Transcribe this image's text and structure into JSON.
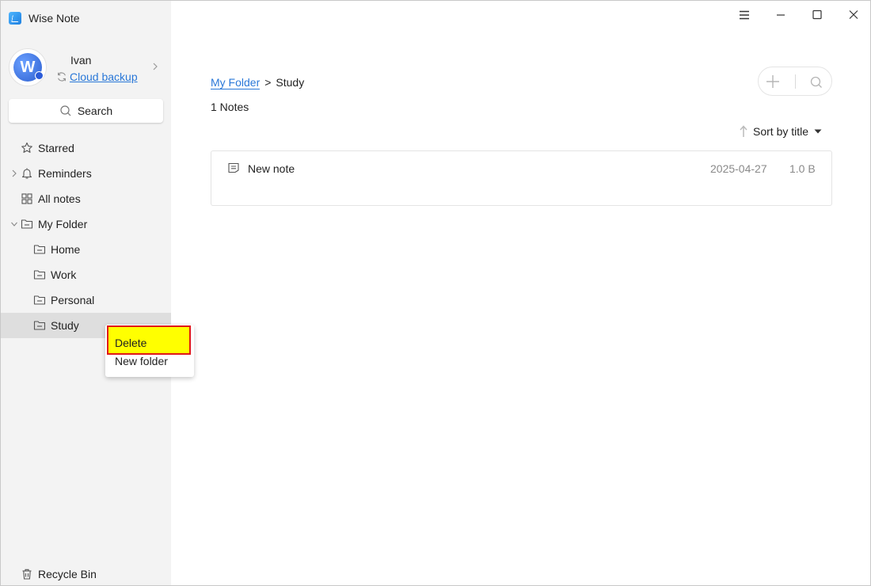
{
  "app": {
    "title": "Wise Note"
  },
  "profile": {
    "avatar_letter": "W",
    "name": "Ivan",
    "cloud_label": "Cloud backup"
  },
  "sidebar": {
    "search_label": "Search",
    "items": [
      {
        "label": "Starred",
        "icon": "star-icon"
      },
      {
        "label": "Reminders",
        "icon": "bell-icon",
        "expandable": true
      },
      {
        "label": "All notes",
        "icon": "grid-icon"
      },
      {
        "label": "My Folder",
        "icon": "folder-icon",
        "expanded": true
      },
      {
        "label": "Home",
        "icon": "folder-icon"
      },
      {
        "label": "Work",
        "icon": "folder-icon"
      },
      {
        "label": "Personal",
        "icon": "folder-icon"
      },
      {
        "label": "Study",
        "icon": "folder-icon",
        "selected": true
      }
    ],
    "recycle_bin": "Recycle Bin"
  },
  "main": {
    "breadcrumb": {
      "parent": "My Folder",
      "separator": ">",
      "current": "Study"
    },
    "note_count": "1 Notes",
    "sort_label": "Sort by title",
    "notes": [
      {
        "title": "New note",
        "date": "2025-04-27",
        "size": "1.0 B"
      }
    ]
  },
  "context_menu": {
    "items": [
      {
        "label": "Delete",
        "highlighted": true
      },
      {
        "label": "New folder"
      }
    ]
  },
  "colors": {
    "accent": "#2a78d8",
    "sidebar_bg": "#f3f3f3",
    "selected_bg": "#dedede",
    "highlight": "#ffff00",
    "highlight_border": "#e01818"
  }
}
